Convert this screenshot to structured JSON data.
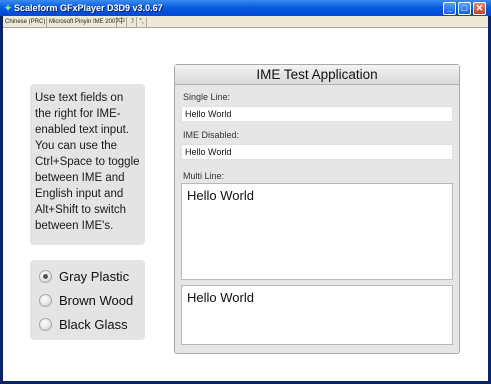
{
  "window": {
    "title": "Scaleform GFxPlayer D3D9 v3.0.67",
    "icon": "scaleform-app-icon",
    "controls": {
      "minimize": "_",
      "maximize": "□",
      "close": "✕"
    }
  },
  "language_bar": {
    "language": "Chinese (PRC)",
    "ime": "Microsoft Pinyin IME 2007",
    "icons": [
      "chinese-mode-icon",
      "half-width-icon",
      "punctuation-icon"
    ]
  },
  "instructions": {
    "text": "Use text fields on the right for IME-enabled text input. You can use the Ctrl+Space to toggle between IME and English input and Alt+Shift to switch between IME's."
  },
  "theme_options": {
    "selected": "Gray Plastic",
    "items": [
      {
        "label": "Gray Plastic",
        "checked": true
      },
      {
        "label": "Brown Wood",
        "checked": false
      },
      {
        "label": "Black Glass",
        "checked": false
      }
    ]
  },
  "app": {
    "title": "IME Test Application",
    "single_line": {
      "label": "Single Line:",
      "value": "Hello World"
    },
    "ime_disabled": {
      "label": "IME Disabled:",
      "value": "Hello World"
    },
    "multi_line": {
      "label": "Multi Line:",
      "value": "Hello World"
    },
    "extra_area": {
      "value": "Hello World"
    }
  }
}
